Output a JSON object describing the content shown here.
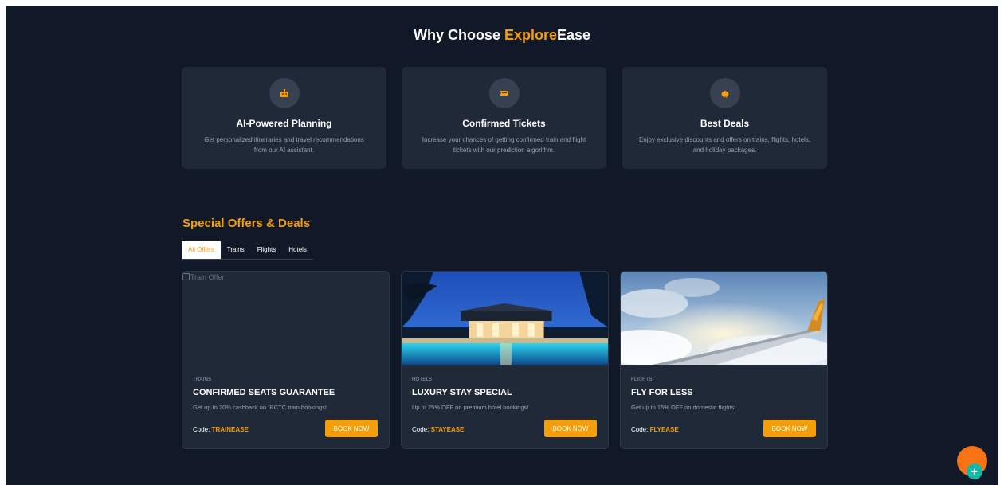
{
  "why": {
    "title_prefix": "Why Choose ",
    "title_accent": "Explore",
    "title_suffix": "Ease"
  },
  "features": [
    {
      "icon": "robot-icon",
      "title": "AI-Powered Planning",
      "desc": "Get personalized itineraries and travel recommendations from our AI assistant."
    },
    {
      "icon": "ticket-icon",
      "title": "Confirmed Tickets",
      "desc": "Increase your chances of getting confirmed train and flight tickets with our prediction algorithm."
    },
    {
      "icon": "piggy-bank-icon",
      "title": "Best Deals",
      "desc": "Enjoy exclusive discounts and offers on trains, flights, hotels, and holiday packages."
    }
  ],
  "offers": {
    "title": "Special Offers & Deals",
    "tabs": [
      "All Offers",
      "Trains",
      "Flights",
      "Hotels"
    ],
    "active_tab": "All Offers"
  },
  "deals": [
    {
      "image_alt": "Train Offer",
      "category": "TRAINS",
      "title": "CONFIRMED SEATS GUARANTEE",
      "desc": "Get up to 20% cashback on IRCTC train bookings!",
      "code_label": "Code:",
      "code": "TRAINEASE",
      "button": "BOOK NOW"
    },
    {
      "image_alt": "Hotel Offer",
      "category": "HOTELS",
      "title": "LUXURY STAY SPECIAL",
      "desc": "Up to 25% OFF on premium hotel bookings!",
      "code_label": "Code:",
      "code": "STAYEASE",
      "button": "BOOK NOW"
    },
    {
      "image_alt": "Flight Offer",
      "category": "FLIGHTS",
      "title": "FLY FOR LESS",
      "desc": "Get up to 15% OFF on domestic flights!",
      "code_label": "Code:",
      "code": "FLYEASE",
      "button": "BOOK NOW"
    }
  ],
  "fab": {
    "icon": "plus-icon",
    "label": "+"
  },
  "colors": {
    "background": "#111827",
    "card": "#1f2937",
    "accent": "#f59e0b",
    "fab": "#f97316",
    "fab_plus": "#14b8a6"
  }
}
